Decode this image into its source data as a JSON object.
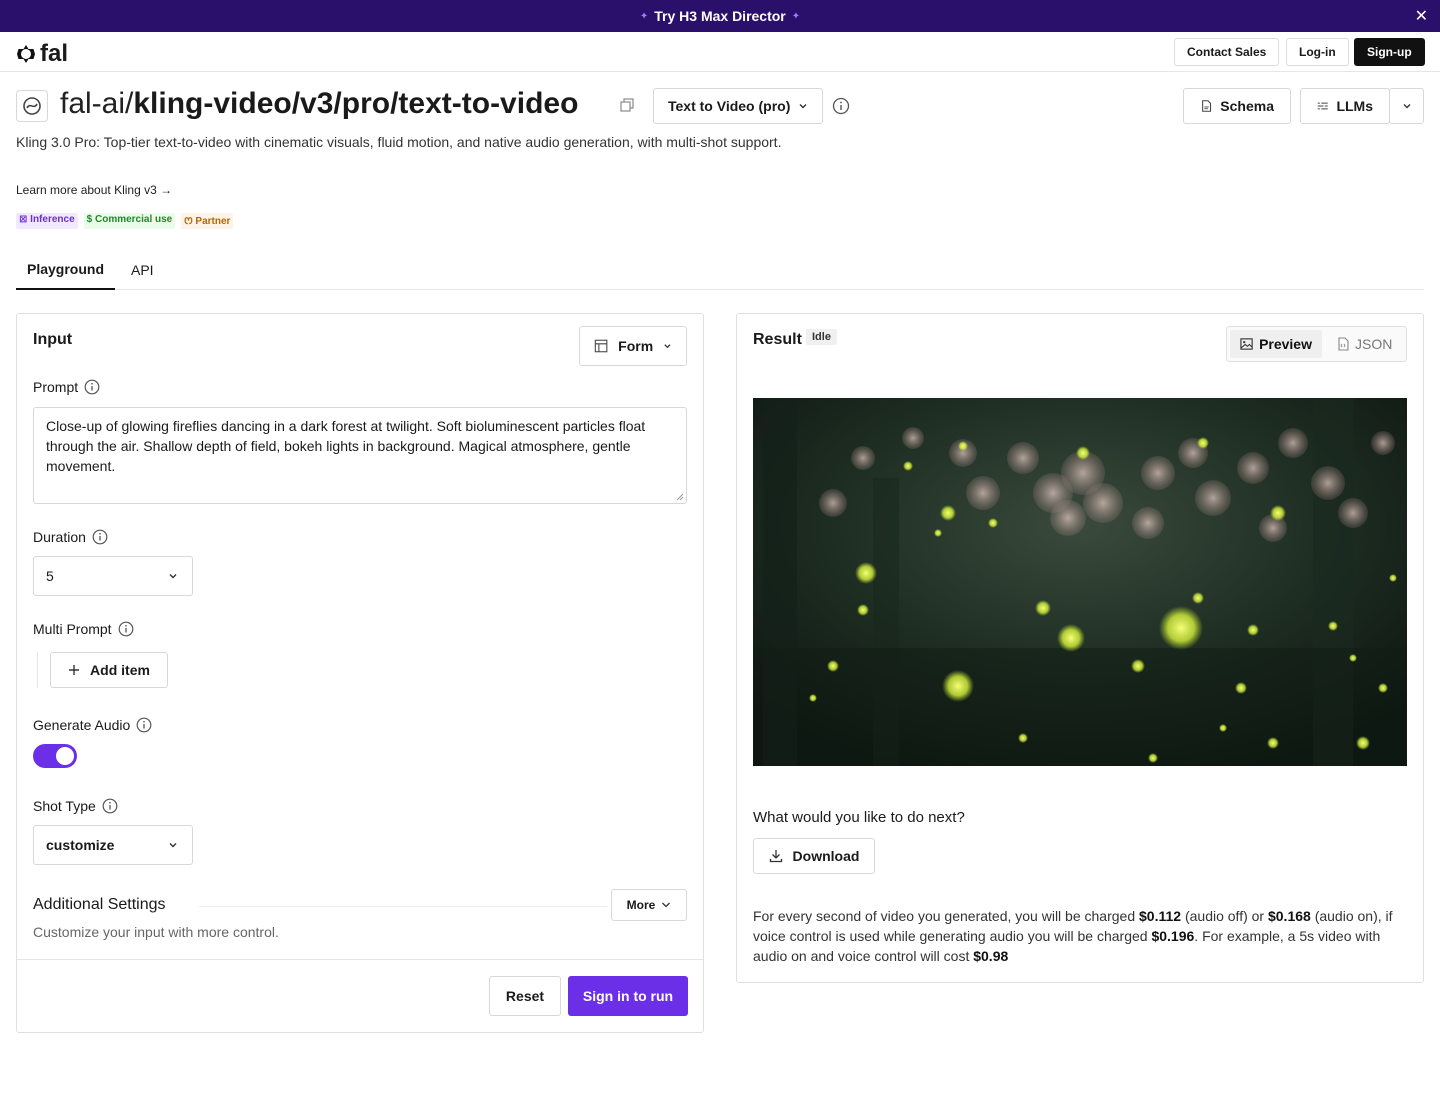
{
  "banner": {
    "text": "Try H3 Max Director"
  },
  "nav": {
    "logo_text": "fal",
    "contact_sales": "Contact Sales",
    "login": "Log-in",
    "signup": "Sign-up"
  },
  "model": {
    "owner": "fal-ai/",
    "slug": "kling-video/v3/pro/text-to-video",
    "variant": "Text to Video (pro)",
    "description": "Kling 3.0 Pro: Top-tier text-to-video with cinematic visuals, fluid motion, and native audio generation, with multi-shot support.",
    "learn_more": "Learn more about Kling v3",
    "learn_more_arrow": "→",
    "schema_label": "Schema",
    "llms_label": "LLMs",
    "tags": {
      "inference": "Inference",
      "commercial": "Commercial use",
      "partner": "Partner"
    }
  },
  "tabs": {
    "playground": "Playground",
    "api": "API"
  },
  "input_panel": {
    "title": "Input",
    "form_mode": "Form",
    "prompt_label": "Prompt",
    "prompt_value": "Close-up of glowing fireflies dancing in a dark forest at twilight. Soft bioluminescent particles float through the air. Shallow depth of field, bokeh lights in background. Magical atmosphere, gentle movement.",
    "duration_label": "Duration",
    "duration_value": "5",
    "multi_prompt_label": "Multi Prompt",
    "add_item": "Add item",
    "generate_audio_label": "Generate Audio",
    "generate_audio_on": true,
    "shot_type_label": "Shot Type",
    "shot_type_value": "customize",
    "additional_title": "Additional Settings",
    "additional_sub": "Customize your input with more control.",
    "more": "More",
    "reset": "Reset",
    "run": "Sign in to run"
  },
  "result_panel": {
    "title": "Result",
    "status": "Idle",
    "preview_tab": "Preview",
    "json_tab": "JSON",
    "next_question": "What would you like to do next?",
    "download": "Download",
    "pricing": {
      "p1": "For every second of video you generated, you will be charged ",
      "price_off": "$0.112",
      "p2": " (audio off) or ",
      "price_on": "$0.168",
      "p3": " (audio on), if voice control is used while generating audio you will be charged ",
      "price_voice": "$0.196",
      "p4": ". For example, a 5s video with audio on and voice control will cost ",
      "price_example": "$0.98"
    }
  },
  "colors": {
    "banner_bg": "#2a0f6b",
    "accent": "#6b2fe8"
  }
}
